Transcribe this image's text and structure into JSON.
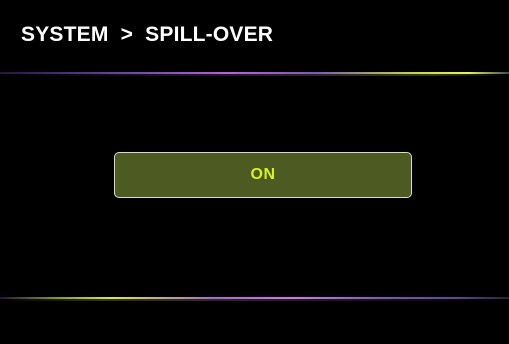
{
  "header": {
    "title": "SYSTEM  >  SPILL-OVER"
  },
  "setting": {
    "state_label": "ON"
  },
  "colors": {
    "background": "#000000",
    "title_text": "#ffffff",
    "button_fill": "#4d5a22",
    "button_border": "#d8dcc8",
    "button_text": "#d7f224"
  }
}
